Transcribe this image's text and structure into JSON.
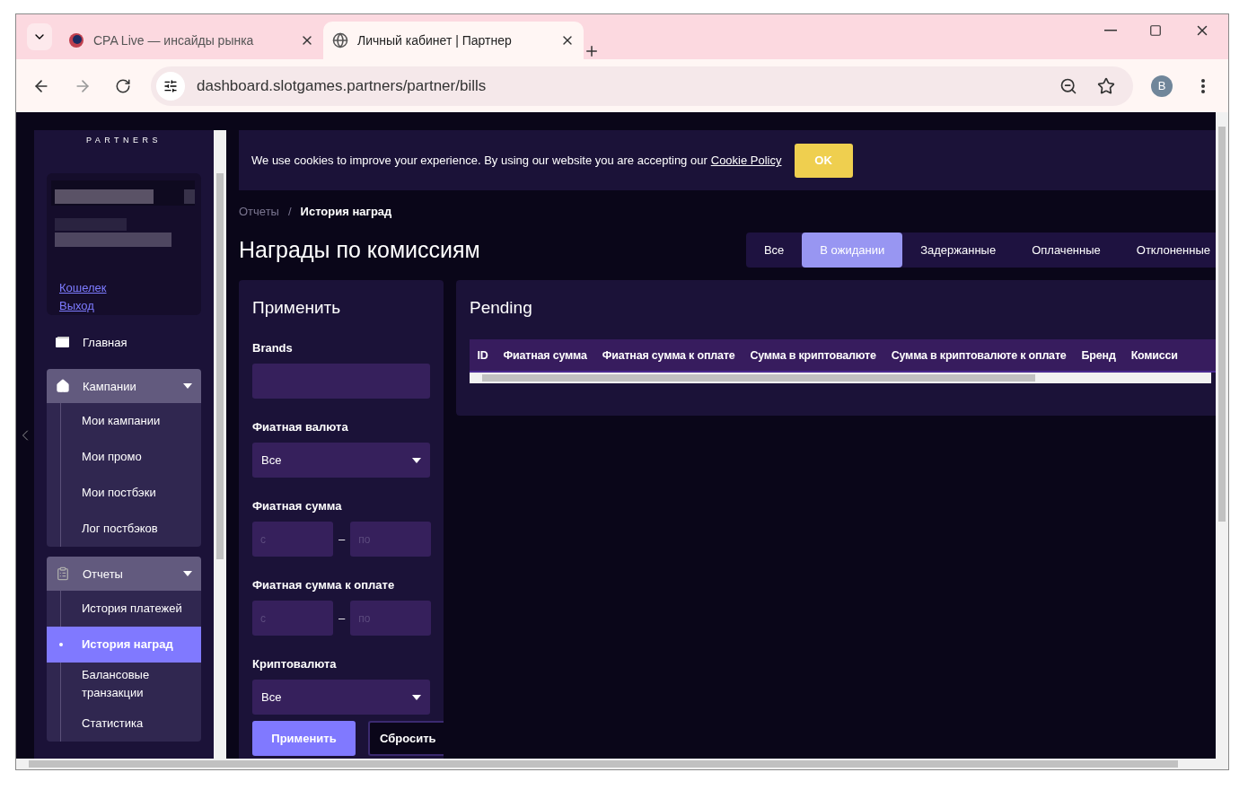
{
  "browser": {
    "tabs": [
      {
        "title": "CPA Live — инсайды рынка",
        "selected": false,
        "kind": "cpa"
      },
      {
        "title": "Личный кабинет | Партнер",
        "selected": true,
        "kind": "globe"
      }
    ],
    "address": "dashboard.slotgames.partners/partner/bills",
    "profile": "B"
  },
  "sidebar": {
    "logo_sub": "PARTNERS",
    "links": [
      "Кошелек",
      "Выход"
    ],
    "nav": [
      {
        "label": "Главная",
        "kind": "link"
      },
      {
        "label": "Кампании",
        "kind": "group",
        "expanded": true,
        "children": [
          {
            "label": "Мои кампании",
            "selected": false
          },
          {
            "label": "Мои промо",
            "selected": false
          },
          {
            "label": "Мои постбэки",
            "selected": false
          },
          {
            "label": "Лог постбэков",
            "selected": false
          }
        ]
      },
      {
        "label": "Отчеты",
        "kind": "group",
        "expanded": true,
        "children": [
          {
            "label": "История платежей",
            "selected": false
          },
          {
            "label": "История наград",
            "selected": true
          },
          {
            "label": "Балансовые транзакции",
            "selected": false
          },
          {
            "label": "Статистика",
            "selected": false
          }
        ]
      }
    ]
  },
  "cookie_banner": {
    "text": "We use cookies to improve your experience. By using our website you are accepting our",
    "link": "Cookie Policy",
    "button": "OK"
  },
  "breadcrumb": [
    {
      "label": "Отчеты",
      "current": false
    },
    {
      "label": "История наград",
      "current": true
    }
  ],
  "separator": "/",
  "title": "Награды по комиссиям",
  "status_tabs": [
    {
      "label": "Все",
      "selected": false
    },
    {
      "label": "В ожидании",
      "selected": true
    },
    {
      "label": "Задержанные",
      "selected": false
    },
    {
      "label": "Оплаченные",
      "selected": false
    },
    {
      "label": "Отклоненные",
      "selected": false
    }
  ],
  "filters": {
    "title": "Применить",
    "fields": [
      {
        "label": "Brands",
        "kind": "input"
      },
      {
        "label": "Фиатная валюта",
        "kind": "select",
        "value": "Все"
      },
      {
        "label": "Фиатная сумма",
        "kind": "range",
        "from": {
          "placeholder": "с"
        },
        "to": {
          "placeholder": "по"
        },
        "dash": "–"
      },
      {
        "label": "Фиатная сумма к оплате",
        "kind": "range",
        "from": {
          "placeholder": "с"
        },
        "to": {
          "placeholder": "по"
        },
        "dash": "–"
      },
      {
        "label": "Криптовалюта",
        "kind": "select",
        "value": "Все"
      }
    ],
    "apply": "Применить",
    "reset": "Сбросить"
  },
  "table": {
    "title": "Pending",
    "columns": [
      "ID",
      "Фиатная сумма",
      "Фиатная сумма к оплате",
      "Сумма в криптовалюте",
      "Сумма в криптовалюте к оплате",
      "Бренд",
      "Комисси"
    ]
  }
}
